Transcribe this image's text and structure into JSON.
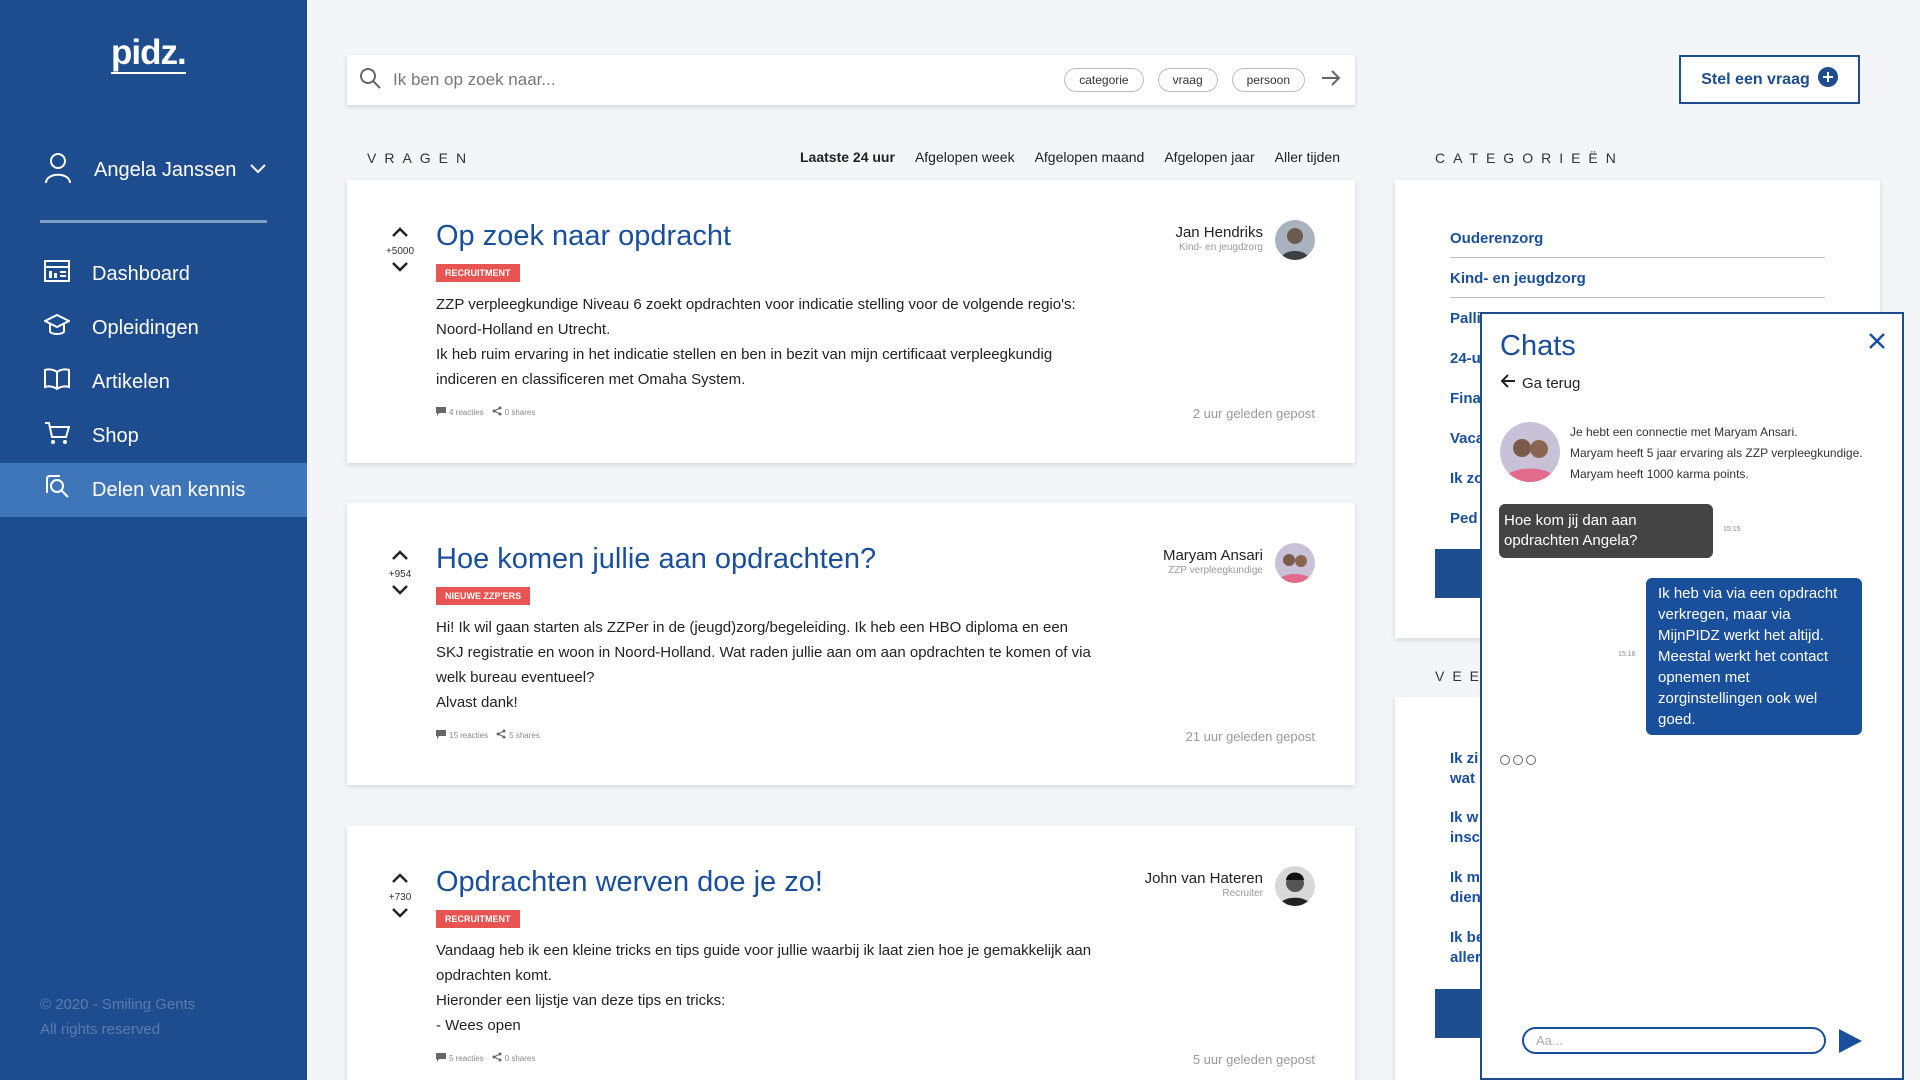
{
  "brand": {
    "logo": "pidz."
  },
  "user": {
    "name": "Angela Janssen"
  },
  "nav": [
    {
      "label": "Dashboard",
      "icon": "dashboard-icon"
    },
    {
      "label": "Opleidingen",
      "icon": "graduation-cap-icon"
    },
    {
      "label": "Artikelen",
      "icon": "book-icon"
    },
    {
      "label": "Shop",
      "icon": "cart-icon"
    },
    {
      "label": "Delen van kennis",
      "icon": "search-chat-icon",
      "active": true
    }
  ],
  "footer": {
    "line1": "© 2020 - Smiling Gents",
    "line2": "All rights reserved"
  },
  "search": {
    "placeholder": "Ik ben op zoek naar...",
    "pills": [
      "categorie",
      "vraag",
      "persoon"
    ]
  },
  "ask_button": {
    "label": "Stel een vraag"
  },
  "questions_section": {
    "label": "VRAGEN"
  },
  "filters": [
    "Laatste 24 uur",
    "Afgelopen week",
    "Afgelopen maand",
    "Afgelopen jaar",
    "Aller tijden"
  ],
  "questions": [
    {
      "votes": "+5000",
      "title": "Op zoek naar opdracht",
      "tag": "RECRUITMENT",
      "body": [
        "ZZP verpleegkundige Niveau 6 zoekt opdrachten voor indicatie stelling voor de volgende regio's:",
        "Noord-Holland en Utrecht.",
        "Ik heb ruim ervaring in het indicatie stellen en ben in bezit van mijn certificaat verpleegkundig",
        "indiceren en classificeren met Omaha System."
      ],
      "reactions": "4 reacties",
      "shares": "0 shares",
      "posted": "2 uur geleden gepost",
      "author": "Jan Hendriks",
      "role": "Kind- en jeugdzorg"
    },
    {
      "votes": "+954",
      "title": "Hoe komen jullie aan opdrachten?",
      "tag": "NIEUWE ZZP'ERS",
      "body": [
        "Hi! Ik wil gaan starten als ZZPer in de (jeugd)zorg/begeleiding. Ik heb een HBO diploma en een",
        "SKJ registratie en woon in Noord-Holland. Wat raden jullie aan om aan opdrachten te komen of via",
        "welk bureau eventueel?",
        "Alvast dank!"
      ],
      "reactions": "15 reacties",
      "shares": "5 shares",
      "posted": "21 uur geleden gepost",
      "author": "Maryam Ansari",
      "role": "ZZP verpleegkundige"
    },
    {
      "votes": "+730",
      "title": "Opdrachten werven doe je zo!",
      "tag": "RECRUITMENT",
      "body": [
        "Vandaag heb ik een kleine tricks en tips guide voor jullie waarbij ik laat zien hoe je gemakkelijk aan",
        "opdrachten komt.",
        "Hieronder een lijstje van deze tips en tricks:",
        "- Wees open"
      ],
      "reactions": "5  reacties",
      "shares": "0 shares",
      "posted": "5 uur geleden gepost",
      "author": "John van Hateren",
      "role": "Recruiter"
    }
  ],
  "categories_section": {
    "label": "CATEGORIEËN",
    "items": [
      "Ouderenzorg",
      "Kind- en jeugdzorg",
      "Palli",
      "24-u",
      "Fina",
      "Vaca",
      "Ik zo",
      "Ped"
    ]
  },
  "veel_section": {
    "label": "VEE",
    "items": [
      [
        "Ik zi",
        "wat"
      ],
      [
        "Ik w",
        "insc"
      ],
      [
        "Ik m",
        "dien"
      ],
      [
        "Ik be",
        "aller"
      ]
    ]
  },
  "chat": {
    "title": "Chats",
    "back": "Ga terug",
    "connection": [
      "Je hebt een connectie met Maryam Ansari.",
      "Maryam heeft 5 jaar ervaring als ZZP verpleegkundige.",
      "Maryam heeft 1000 karma points."
    ],
    "incoming": {
      "text": "Hoe kom jij dan aan opdrachten Angela?",
      "time": "15:15"
    },
    "outgoing": {
      "text": "Ik heb via via een opdracht verkregen, maar via MijnPIDZ werkt het altijd. Meestal werkt het contact opnemen met zorginstellingen ook wel goed.",
      "time": "15:16"
    },
    "input_placeholder": "Aa..."
  },
  "colors": {
    "sidebar": "#1e4d8f",
    "active": "#3f76b9",
    "title": "#1a4f9c",
    "badge": "#e85451"
  }
}
